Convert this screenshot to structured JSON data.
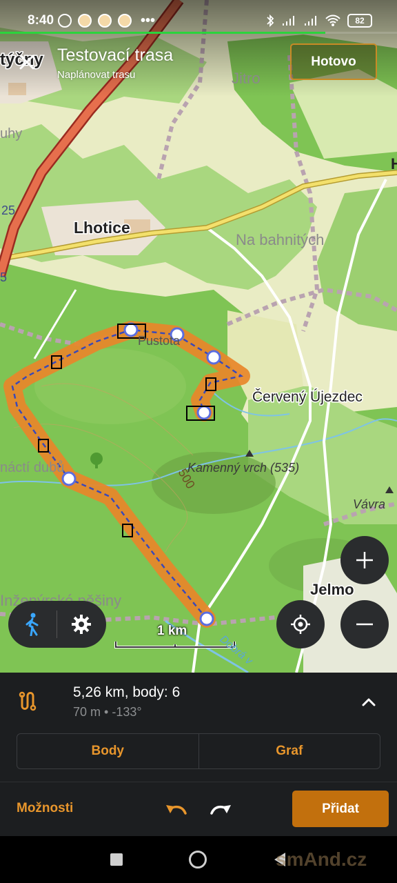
{
  "status_bar": {
    "time": "8:40",
    "battery": "82",
    "more": "•••"
  },
  "top_bar": {
    "title": "Testovací trasa",
    "subtitle": "Naplánovat trasu",
    "done_label": "Hotovo"
  },
  "map": {
    "labels": {
      "town_partial": "týčny",
      "jitro": "Jitro",
      "uhy": "uhy",
      "road_25": "25",
      "road_5": "5",
      "lhotice": "Lhotice",
      "na_bahnitych": "Na bahnitých",
      "pustota": "Pustota",
      "cerveny_ujezdec": "Červený Újezdec",
      "kamenny_vrch": "Kamenný vrch (535)",
      "contour_500": "500",
      "vavra": "Vávra",
      "nacti_dubu": "náctí dubů",
      "inzenyrske": "Inženýrské pěšiny",
      "jelmo": "Jelmo",
      "edge_h": "H",
      "dobra": "Dobrá v"
    },
    "scale_label": "1 km",
    "icons": {
      "mode": "pedestrian-icon",
      "settings": "gear-icon",
      "location": "my-location-icon",
      "zoom_in": "plus-icon",
      "zoom_out": "minus-icon"
    }
  },
  "summary": {
    "main": "5,26 km, body: 6",
    "sub": "70 m • -133°"
  },
  "tabs": {
    "points": "Body",
    "graph": "Graf"
  },
  "actions": {
    "options": "Možnosti",
    "add": "Přidat"
  },
  "watermark": "smAnd.cz",
  "colors": {
    "accent": "#e8962c",
    "add_button": "#c2700d",
    "route": "#e8862a",
    "panel": "#1c1e20",
    "map_green": "#7fc454"
  }
}
